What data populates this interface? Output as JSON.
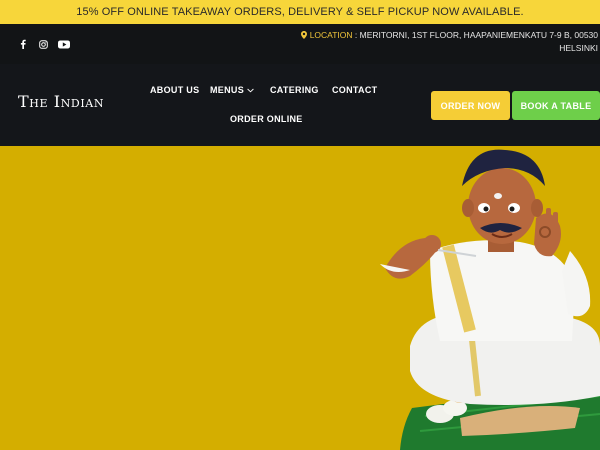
{
  "promo": {
    "text": "15% OFF ONLINE TAKEAWAY ORDERS, DELIVERY & SELF PICKUP NOW AVAILABLE."
  },
  "topbar": {
    "social_icons": [
      "facebook-icon",
      "instagram-icon",
      "youtube-icon"
    ],
    "location_label": "LOCATION",
    "location_line1": " : MERITORNI, 1ST FLOOR, HAAPANIEMENKATU 7-9 B, 00530",
    "location_line2": "HELSINKI"
  },
  "nav": {
    "logo": "The Indian",
    "items": {
      "about": "ABOUT US",
      "menus": "MENUS",
      "catering": "CATERING",
      "contact": "CONTACT",
      "order_online": "ORDER ONLINE"
    },
    "order_now": "ORDER NOW",
    "book_table": "BOOK A TABLE"
  },
  "colors": {
    "promo_bg": "#f7d63a",
    "header_bg": "#14161a",
    "accent_yellow": "#f5cd36",
    "accent_green": "#6ecf4a",
    "hero_bg": "#d4ae00"
  },
  "hero": {
    "illustration": "man-eating-banana-leaf-meal-illustration"
  }
}
